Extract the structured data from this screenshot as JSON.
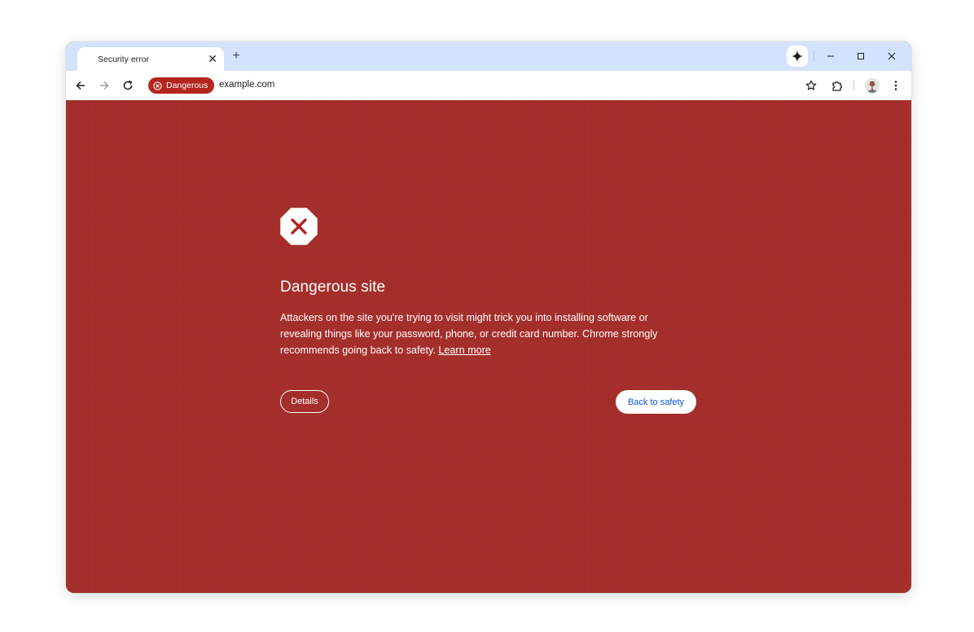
{
  "tab": {
    "title": "Security error",
    "close_icon": "close-icon"
  },
  "toolbar": {
    "security_chip": "Dangerous",
    "url": "example.com"
  },
  "page": {
    "heading": "Dangerous site",
    "body": "Attackers on the site you're trying to visit might trick you into installing software or revealing things like your password, phone, or credit card number. Chrome strongly recommends going back to safety.",
    "learn_more": "Learn more",
    "details_button": "Details",
    "back_button": "Back to safety"
  },
  "colors": {
    "page_background": "#a8302c",
    "tabstrip": "#d3e3fd",
    "chip": "#b3261e",
    "primary_button_text": "#0b57d0"
  }
}
